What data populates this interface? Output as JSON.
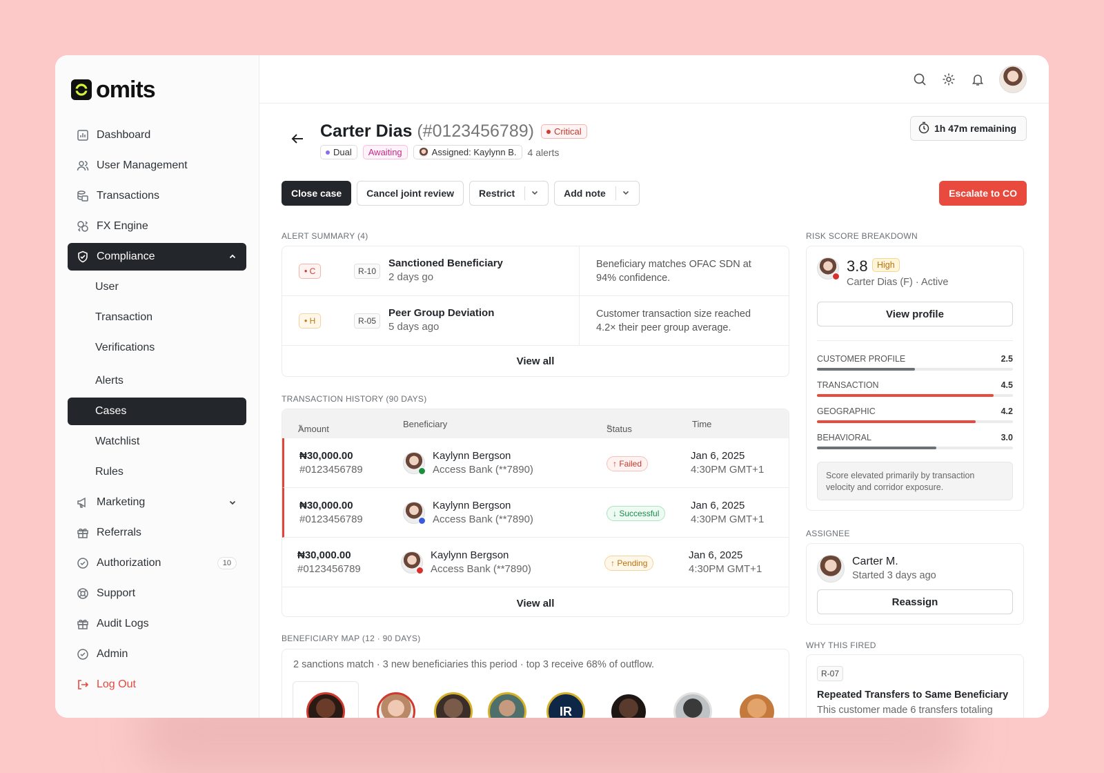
{
  "brand": {
    "name": "omits"
  },
  "sidebar": {
    "items": [
      {
        "label": "Dashboard",
        "icon": "chart-icon"
      },
      {
        "label": "User Management",
        "icon": "users-icon"
      },
      {
        "label": "Transactions",
        "icon": "coins-icon"
      },
      {
        "label": "FX Engine",
        "icon": "exchange-icon"
      }
    ],
    "compliance": {
      "label": "Compliance",
      "icon": "shield-check-icon",
      "expanded": true,
      "children": [
        "User",
        "Transaction",
        "Verifications",
        "Alerts",
        "Cases",
        "Watchlist",
        "Rules"
      ],
      "active_child": "Cases"
    },
    "items_after": [
      {
        "label": "Marketing",
        "icon": "megaphone-icon"
      },
      {
        "label": "Referrals",
        "icon": "gift-icon"
      },
      {
        "label": "Authorization",
        "icon": "check-circle-icon",
        "count": "10"
      },
      {
        "label": "Support",
        "icon": "lifebuoy-icon"
      },
      {
        "label": "Audit Logs",
        "icon": "gift-icon"
      },
      {
        "label": "Admin",
        "icon": "check-circle-icon"
      }
    ],
    "logout": "Log Out"
  },
  "case": {
    "name": "Carter Dias",
    "id": "(#0123456789)",
    "severity": "Critical",
    "review_type": "Dual",
    "status": "Awaiting",
    "assigned": "Assigned: Kaylynn B.",
    "alerts_count": "4 alerts",
    "timer": "1h 47m remaining"
  },
  "actions": {
    "close": "Close case",
    "cancel_joint": "Cancel joint review",
    "restrict": "Restrict",
    "add_note": "Add note",
    "escalate": "Escalate to CO"
  },
  "alert_summary": {
    "label": "ALERT SUMMARY (4)",
    "rows": [
      {
        "severity": "C",
        "rule": "R-10",
        "title": "Sanctioned Beneficiary",
        "age": "2 days go",
        "desc_1": "Beneficiary matches OFAC SDN at",
        "desc_2": "94% confidence."
      },
      {
        "severity": "H",
        "rule": "R-05",
        "title": "Peer Group Deviation",
        "age": "5 days ago",
        "desc_1": "Customer transaction size reached",
        "desc_2": "4.2× their peer group average."
      }
    ],
    "view_all": "View all"
  },
  "transactions": {
    "label": "TRANSACTION HISTORY (90 DAYS)",
    "columns": [
      "Amount",
      "Beneficiary",
      "Status",
      "Time"
    ],
    "rows": [
      {
        "amount": "₦30,000.00",
        "id": "#0123456789",
        "name": "Kaylynn Bergson",
        "bank": "Access Bank (**7890)",
        "status": "Failed",
        "date": "Jan 6, 2025",
        "time": "4:30PM GMT+1",
        "flag_color": "#1a8f3f"
      },
      {
        "amount": "₦30,000.00",
        "id": "#0123456789",
        "name": "Kaylynn Bergson",
        "bank": "Access Bank (**7890)",
        "status": "Successful",
        "date": "Jan 6, 2025",
        "time": "4:30PM GMT+1",
        "flag_color": "#3b5bdb"
      },
      {
        "amount": "₦30,000.00",
        "id": "#0123456789",
        "name": "Kaylynn Bergson",
        "bank": "Access Bank (**7890)",
        "status": "Pending",
        "date": "Jan 6, 2025",
        "time": "4:30PM GMT+1",
        "flag_color": "#d6312c"
      }
    ],
    "view_all": "View all"
  },
  "beneficiary_map": {
    "label": "BENEFICIARY MAP (12 · 90 DAYS)",
    "summary": "2 sanctions match · 3 new beneficiaries this period · top 3 receive 68% of outflow.",
    "initials": "IR"
  },
  "risk": {
    "label": "RISK SCORE BREAKDOWN",
    "score": "3.8",
    "level": "High",
    "customer": "Carter Dias (F) · Active",
    "view_profile": "View profile",
    "metrics": [
      {
        "name": "CUSTOMER PROFILE",
        "value": "2.5",
        "fraction": 0.5,
        "color": "#6b7177"
      },
      {
        "name": "TRANSACTION",
        "value": "4.5",
        "fraction": 0.9,
        "color": "#e84a3e"
      },
      {
        "name": "GEOGRAPHIC",
        "value": "4.2",
        "fraction": 0.81,
        "color": "#e84a3e"
      },
      {
        "name": "BEHAVIORAL",
        "value": "3.0",
        "fraction": 0.61,
        "color": "#6b7177"
      }
    ],
    "note_1": "Score elevated primarily by transaction",
    "note_2": "velocity and corridor exposure."
  },
  "assignee": {
    "label": "ASSIGNEE",
    "name": "Carter M.",
    "started": "Started 3 days ago",
    "reassign": "Reassign"
  },
  "why_fired": {
    "label": "WHY THIS FIRED",
    "rule": "R-07",
    "title": "Repeated Transfers to Same Beneficiary",
    "desc": "This customer made 6 transfers totaling"
  }
}
